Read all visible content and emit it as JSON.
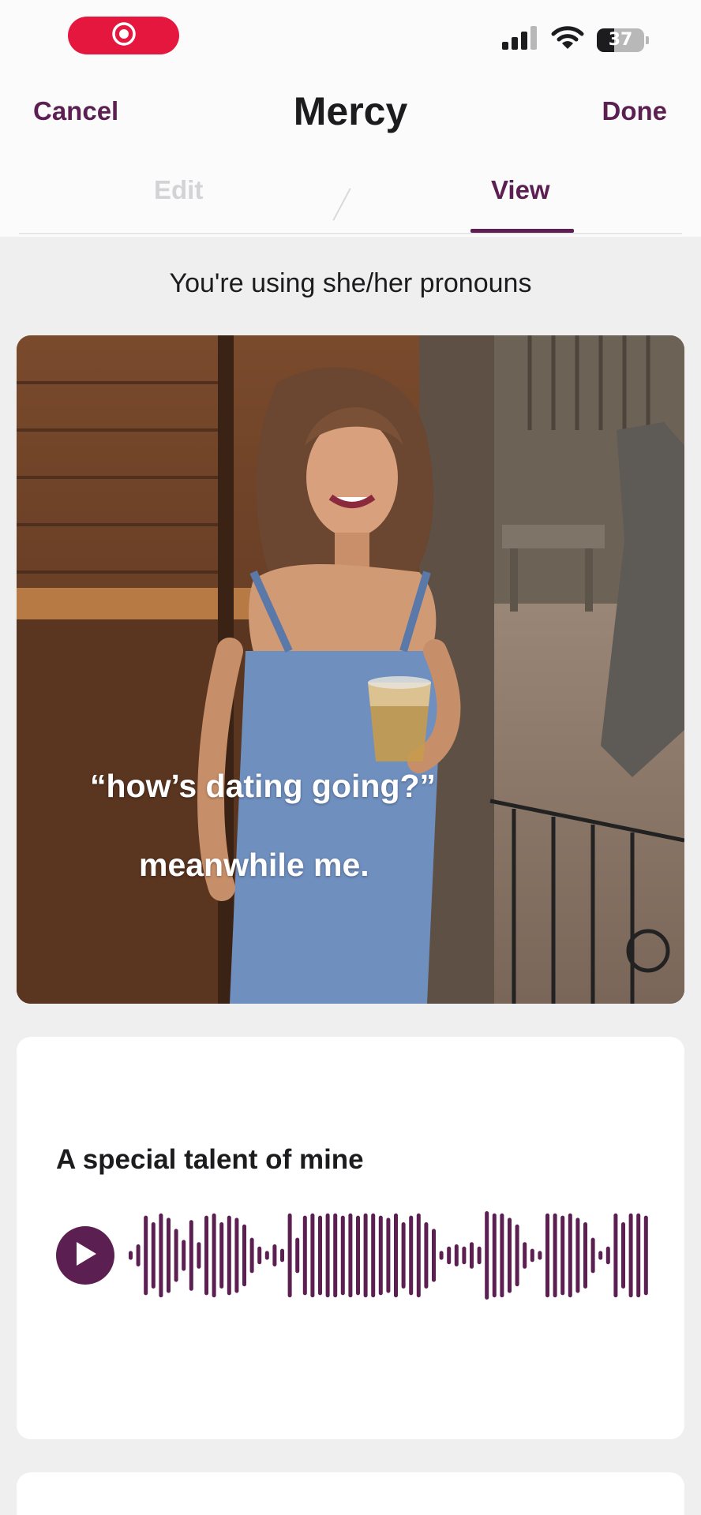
{
  "status_bar": {
    "recording_icon": "record-icon",
    "signal_icon": "cellular-signal-icon",
    "wifi_icon": "wifi-icon",
    "battery_level": "37",
    "battery_fraction": 0.37
  },
  "header": {
    "cancel_label": "Cancel",
    "title": "Mercy",
    "done_label": "Done"
  },
  "tabs": [
    {
      "label": "Edit",
      "active": false
    },
    {
      "label": "View",
      "active": true
    }
  ],
  "pronouns_text": "You're using she/her pronouns",
  "photo": {
    "caption_line1": "“how’s dating going?”",
    "caption_line2": "meanwhile me."
  },
  "voice_prompt": {
    "title": "A special talent of mine",
    "play_icon": "play-icon",
    "waveform_levels": [
      0.1,
      0.25,
      0.9,
      0.75,
      0.95,
      0.85,
      0.6,
      0.35,
      0.8,
      0.3,
      0.9,
      0.95,
      0.75,
      0.9,
      0.85,
      0.7,
      0.4,
      0.2,
      0.1,
      0.25,
      0.15,
      0.95,
      0.4,
      0.9,
      0.95,
      0.9,
      0.95,
      0.95,
      0.9,
      0.95,
      0.9,
      0.95,
      0.95,
      0.9,
      0.85,
      0.95,
      0.75,
      0.9,
      0.95,
      0.75,
      0.6,
      0.1,
      0.2,
      0.25,
      0.2,
      0.3,
      0.2,
      1.0,
      0.95,
      0.95,
      0.85,
      0.7,
      0.3,
      0.15,
      0.1,
      0.95,
      0.95,
      0.9,
      0.95,
      0.85,
      0.75,
      0.4,
      0.1,
      0.2,
      0.95,
      0.75,
      0.95,
      0.95,
      0.9
    ],
    "accent_color": "#5c1f52"
  }
}
